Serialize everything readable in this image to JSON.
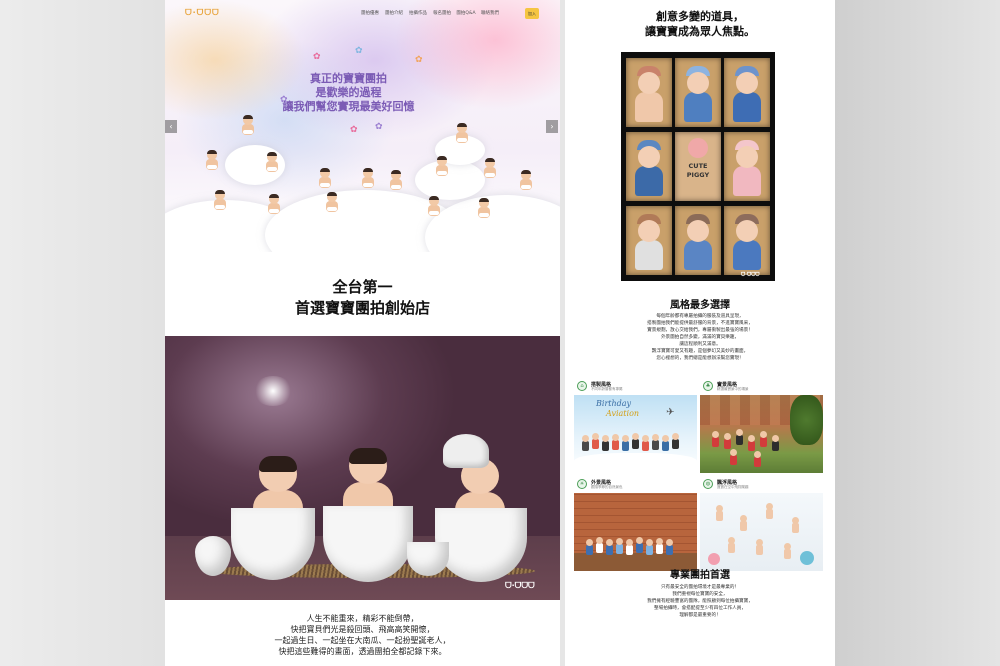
{
  "left_page": {
    "logo": "ᗜ·ᗜᗜᗜ",
    "nav": {
      "items": [
        "團拍優惠",
        "團拍介紹",
        "拍攝作品",
        "報名團拍",
        "團拍Q&A",
        "聯絡我們"
      ],
      "cta": "加入"
    },
    "hero": {
      "line1": "真正的寶寶團拍",
      "line2": "是歡樂的過程",
      "line3": "讓我們幫您實現最美好回憶",
      "prev_arrow": "‹",
      "next_arrow": "›"
    },
    "heading": {
      "line1": "全台第一",
      "line2": "首選寶寶團拍創始店"
    },
    "photo_watermark": "ᗜ·ᗜᗜᗜ",
    "paragraph": [
      "人生不能重來，精彩不能倒帶，",
      "快把寶貝們光是殺回頭、飛高高笑開懷，",
      "一起過生日、一起坐在大南瓜、一起扮聖誕老人，",
      "快把這些難得的畫面，透過團拍全都記錄下來。"
    ]
  },
  "right_page": {
    "heading": {
      "line1": "創意多變的道具，",
      "line2": "讓寶寶成為眾人焦點。"
    },
    "photo": {
      "line1": "CUTE",
      "line2": "PIGGY",
      "logo": "ᗜ·ᗜᗜᗜ"
    },
    "style_section": {
      "title": "風格最多選擇",
      "lines": [
        "每個年齡都有專屬拍攝的服裝及道具呈現，",
        "搭製團拍我們能提供最舒服的背景，不進寶寶風采，",
        "實景規劃，放心交給我們，專屬衝製出最強的場景！",
        "外景團拍自然多變，滿滿的寶貝樂趣，",
        "讓這程順利又滿意。",
        "飄浮寶寶可愛又有趣，是個夢幻又美妙的畫面，",
        "您心裡想的，我們總是能想辦法幫您實現！"
      ]
    },
    "styles": [
      {
        "title": "搭製風格",
        "sub": "不同年齡層都有專屬",
        "icon": "house-icon"
      },
      {
        "title": "實景風格",
        "sub": "精選最實景中的場景",
        "icon": "tree-icon"
      },
      {
        "title": "外景風格",
        "sub": "跟隨季節的自然景色",
        "icon": "sun-icon"
      },
      {
        "title": "飄浮風格",
        "sub": "寶寶在空中飛翔樂趣",
        "icon": "balloon-icon"
      }
    ],
    "styles_img1_text": {
      "line1": "Birthday",
      "line2": "Aviation"
    },
    "pro_section": {
      "title": "專業團拍首選",
      "lines": [
        "只有最安全的團拍環境才是最專業的！",
        "我們重視每位寶寶的安全，",
        "我們擁有經驗豐富的團隊，能照顧到每位拍攝寶寶，",
        "整場拍攝時，會搭配提至少有四位工作人員，",
        "理解都是最重要的！"
      ]
    }
  },
  "colors": {
    "accent_yellow": "#f5c542",
    "hero_purple": "#7b5bb5",
    "style_green": "#4b9e57"
  }
}
